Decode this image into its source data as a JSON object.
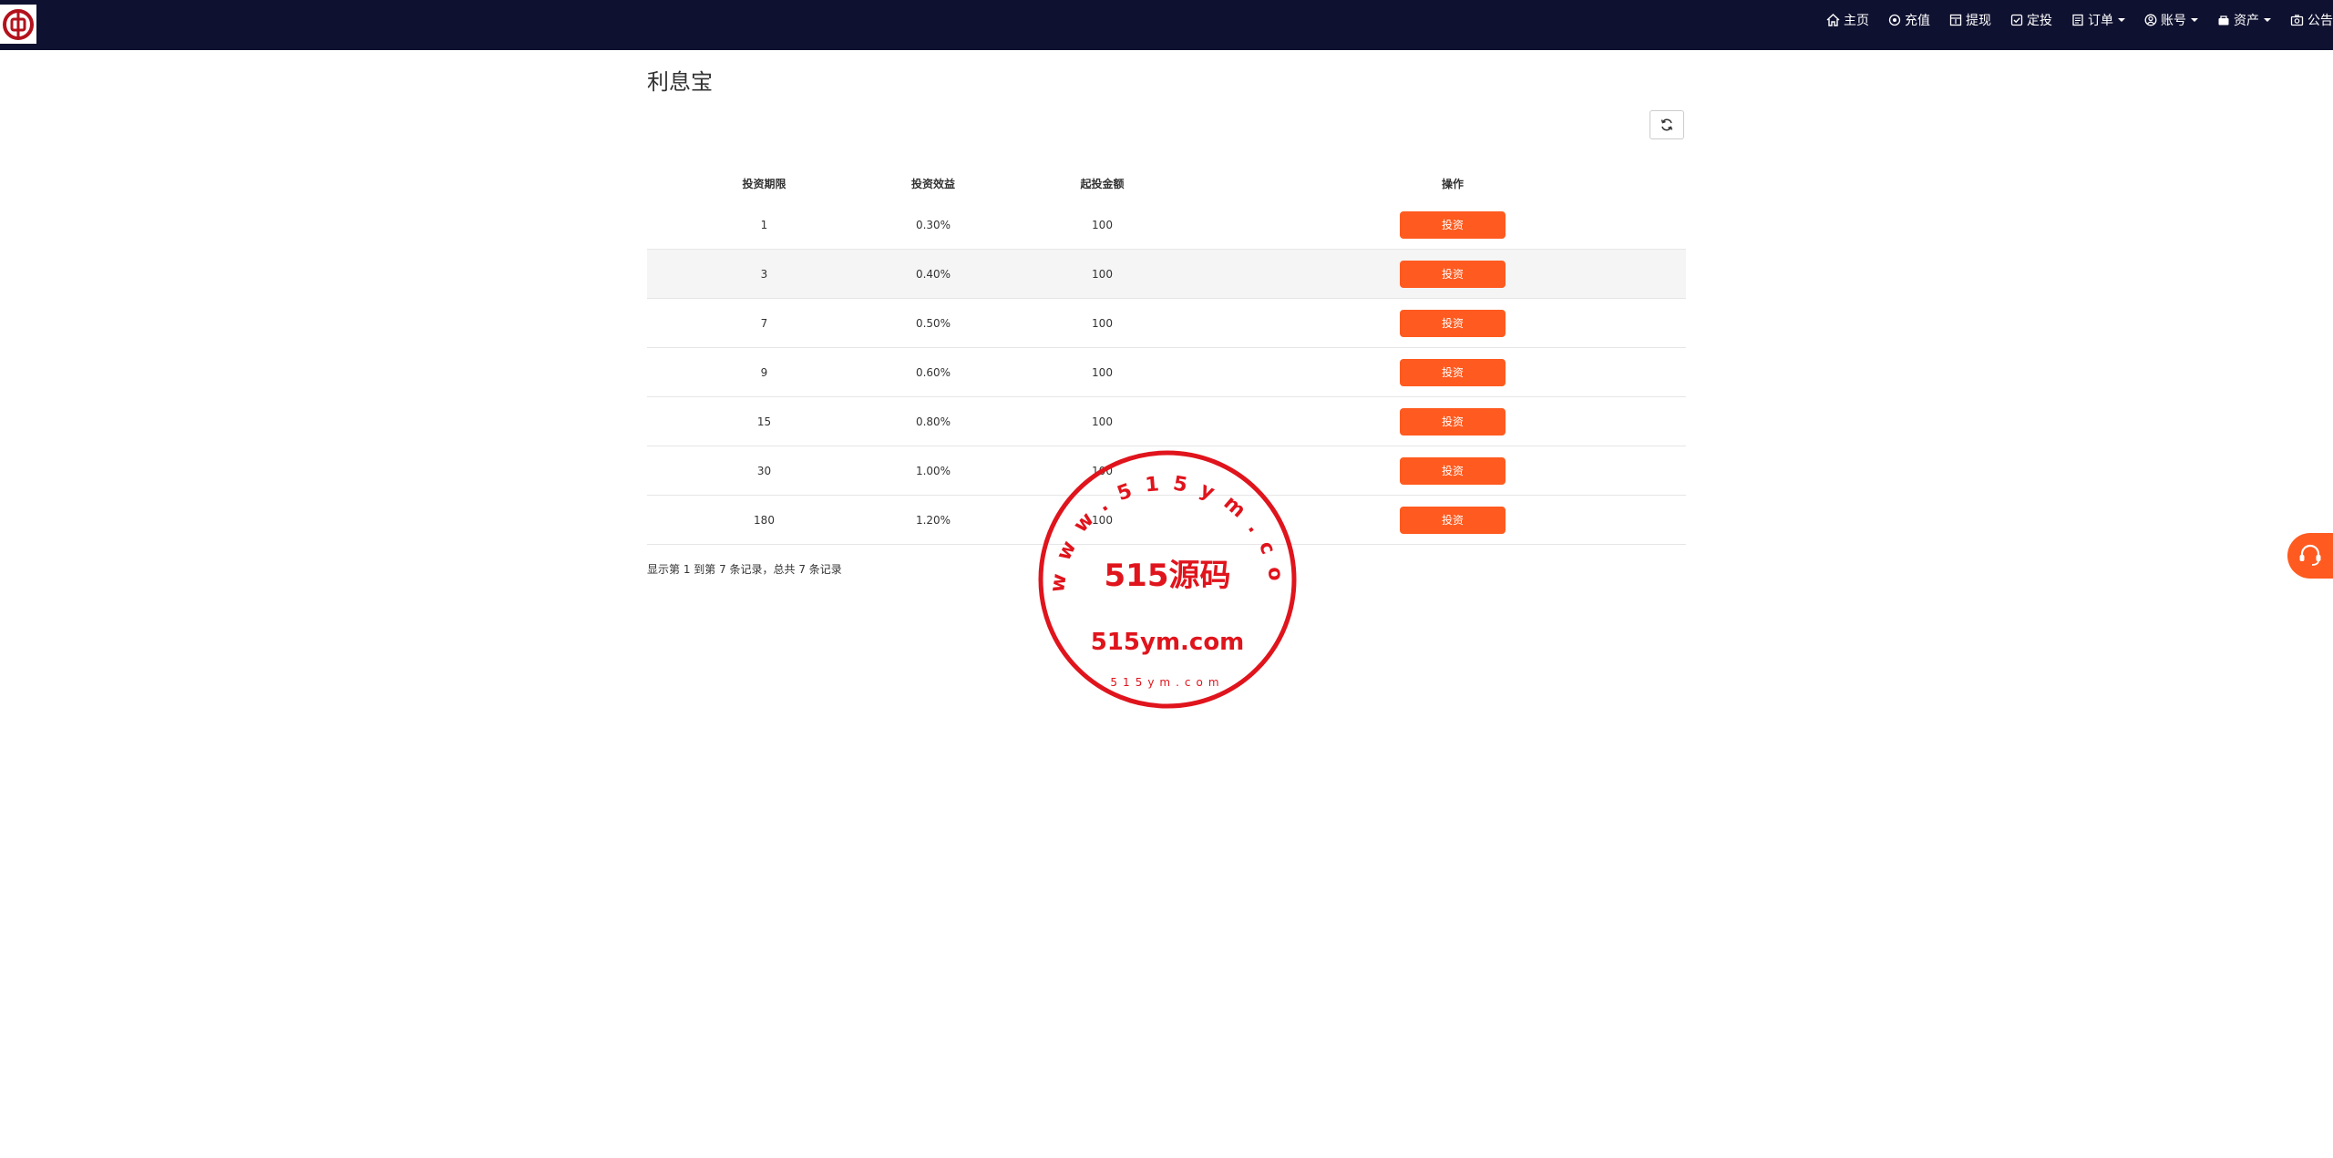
{
  "header": {
    "nav": [
      {
        "label": "主页",
        "icon": "home-icon"
      },
      {
        "label": "充值",
        "icon": "recharge-icon"
      },
      {
        "label": "提现",
        "icon": "withdraw-icon"
      },
      {
        "label": "定投",
        "icon": "fixed-invest-icon"
      },
      {
        "label": "订单",
        "icon": "order-icon"
      },
      {
        "label": "账号",
        "icon": "account-icon"
      },
      {
        "label": "资产",
        "icon": "assets-icon"
      },
      {
        "label": "公告",
        "icon": "notice-icon"
      }
    ]
  },
  "page": {
    "title": "利息宝"
  },
  "table": {
    "headers": [
      "投资期限",
      "投资效益",
      "起投金额",
      "操作"
    ],
    "rows": [
      {
        "term": "1",
        "rate": "0.30%",
        "min": "100",
        "action": "投资"
      },
      {
        "term": "3",
        "rate": "0.40%",
        "min": "100",
        "action": "投资"
      },
      {
        "term": "7",
        "rate": "0.50%",
        "min": "100",
        "action": "投资"
      },
      {
        "term": "9",
        "rate": "0.60%",
        "min": "100",
        "action": "投资"
      },
      {
        "term": "15",
        "rate": "0.80%",
        "min": "100",
        "action": "投资"
      },
      {
        "term": "30",
        "rate": "1.00%",
        "min": "100",
        "action": "投资"
      },
      {
        "term": "180",
        "rate": "1.20%",
        "min": "100",
        "action": "投资"
      }
    ],
    "summary": "显示第 1 到第 7 条记录，总共 7 条记录"
  },
  "colors": {
    "topbar": "#0f1130",
    "accent": "#ff5a1f",
    "stamp": "#e0141c"
  }
}
